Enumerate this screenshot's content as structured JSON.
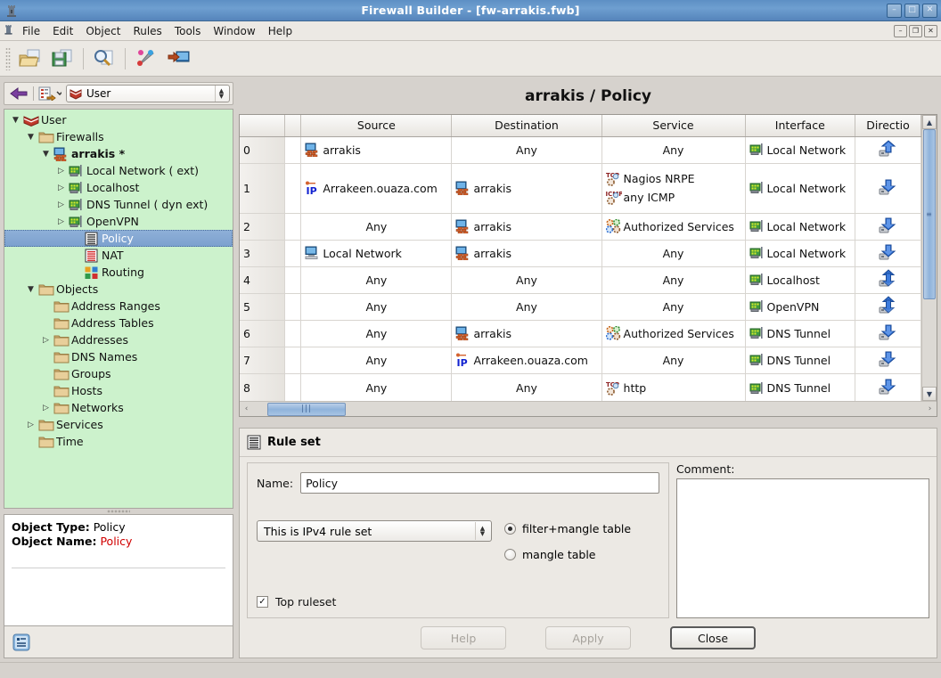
{
  "window": {
    "title": "Firewall Builder  - [fw-arrakis.fwb]",
    "app_icon": "firewall-tower-icon",
    "buttons": {
      "minimize": "–",
      "maximize": "□",
      "close": "✕"
    }
  },
  "menubar": {
    "icon": "firewall-tower-icon",
    "items": [
      "File",
      "Edit",
      "Object",
      "Rules",
      "Tools",
      "Window",
      "Help"
    ],
    "mdi_buttons": {
      "minimize": "–",
      "restore": "❐",
      "close": "✕"
    }
  },
  "toolbar": {
    "buttons": [
      {
        "name": "open-file-button",
        "icon": "open-folder-icon"
      },
      {
        "name": "save-file-button",
        "icon": "floppy-save-icon"
      },
      {
        "name": "find-button",
        "icon": "magnifier-document-icon"
      },
      {
        "name": "compile-button",
        "icon": "wrench-balls-icon"
      },
      {
        "name": "install-button",
        "icon": "install-to-monitor-icon"
      }
    ]
  },
  "navbar": {
    "back_icon": "back-arrow-icon",
    "new_object_icon": "new-object-icon",
    "dropdown_icon": "chevron-down-icon",
    "library_icon": "library-books-icon",
    "library_value": "User"
  },
  "tree": {
    "items": [
      {
        "label": "User",
        "indent": 0,
        "twisty": "down",
        "icon": "library-books-icon",
        "selected": false,
        "bold": false
      },
      {
        "label": "Firewalls",
        "indent": 1,
        "twisty": "down",
        "icon": "folder-icon",
        "selected": false,
        "bold": false
      },
      {
        "label": "arrakis *",
        "indent": 2,
        "twisty": "down",
        "icon": "firewall-icon",
        "selected": false,
        "bold": true
      },
      {
        "label": "Local Network ( ext)",
        "indent": 3,
        "twisty": "right",
        "icon": "interface-card-icon",
        "selected": false,
        "bold": false
      },
      {
        "label": "Localhost",
        "indent": 3,
        "twisty": "right",
        "icon": "interface-card-icon",
        "selected": false,
        "bold": false
      },
      {
        "label": "DNS Tunnel ( dyn ext)",
        "indent": 3,
        "twisty": "right",
        "icon": "interface-card-icon",
        "selected": false,
        "bold": false
      },
      {
        "label": "OpenVPN",
        "indent": 3,
        "twisty": "right",
        "icon": "interface-card-icon",
        "selected": false,
        "bold": false
      },
      {
        "label": "Policy",
        "indent": 4,
        "twisty": "none",
        "icon": "policy-rules-icon",
        "selected": true,
        "bold": false
      },
      {
        "label": "NAT",
        "indent": 4,
        "twisty": "none",
        "icon": "nat-rules-icon",
        "selected": false,
        "bold": false
      },
      {
        "label": "Routing",
        "indent": 4,
        "twisty": "none",
        "icon": "routing-icon",
        "selected": false,
        "bold": false
      },
      {
        "label": "Objects",
        "indent": 1,
        "twisty": "down",
        "icon": "folder-icon",
        "selected": false,
        "bold": false
      },
      {
        "label": "Address Ranges",
        "indent": 2,
        "twisty": "none",
        "icon": "folder-icon",
        "selected": false,
        "bold": false
      },
      {
        "label": "Address Tables",
        "indent": 2,
        "twisty": "none",
        "icon": "folder-icon",
        "selected": false,
        "bold": false
      },
      {
        "label": "Addresses",
        "indent": 2,
        "twisty": "right",
        "icon": "folder-icon",
        "selected": false,
        "bold": false
      },
      {
        "label": "DNS Names",
        "indent": 2,
        "twisty": "none",
        "icon": "folder-icon",
        "selected": false,
        "bold": false
      },
      {
        "label": "Groups",
        "indent": 2,
        "twisty": "none",
        "icon": "folder-icon",
        "selected": false,
        "bold": false
      },
      {
        "label": "Hosts",
        "indent": 2,
        "twisty": "none",
        "icon": "folder-icon",
        "selected": false,
        "bold": false
      },
      {
        "label": "Networks",
        "indent": 2,
        "twisty": "right",
        "icon": "folder-icon",
        "selected": false,
        "bold": false
      },
      {
        "label": "Services",
        "indent": 1,
        "twisty": "right",
        "icon": "folder-icon",
        "selected": false,
        "bold": false
      },
      {
        "label": "Time",
        "indent": 1,
        "twisty": "none",
        "icon": "folder-icon",
        "selected": false,
        "bold": false
      }
    ]
  },
  "object_info": {
    "type_label": "Object Type:",
    "type_value": "Policy",
    "name_label": "Object Name:",
    "name_value": "Policy",
    "name_color": "#d10000",
    "bottom_icon": "object-info-icon"
  },
  "ruleset_view": {
    "title": "arrakis / Policy",
    "columns": [
      "",
      "",
      "Source",
      "Destination",
      "Service",
      "Interface",
      "Directio"
    ],
    "rows": [
      {
        "num": "0",
        "source": [
          {
            "text": "arrakis",
            "icon": "firewall-icon"
          }
        ],
        "destination": [
          {
            "text": "Any",
            "icon": "none"
          }
        ],
        "service": [
          {
            "text": "Any",
            "icon": "none"
          }
        ],
        "interface": [
          {
            "text": "Local Network",
            "icon": "interface-card-icon"
          }
        ],
        "direction": "outbound"
      },
      {
        "num": "1",
        "source": [
          {
            "text": "Arrakeen.ouaza.com",
            "icon": "ip-address-icon"
          }
        ],
        "destination": [
          {
            "text": "arrakis",
            "icon": "firewall-icon"
          }
        ],
        "service": [
          {
            "text": "Nagios NRPE",
            "icon": "tcp-service-icon"
          },
          {
            "text": "any ICMP",
            "icon": "icmp-service-icon"
          }
        ],
        "interface": [
          {
            "text": "Local Network",
            "icon": "interface-card-icon"
          }
        ],
        "direction": "inbound"
      },
      {
        "num": "2",
        "source": [
          {
            "text": "Any",
            "icon": "none"
          }
        ],
        "destination": [
          {
            "text": "arrakis",
            "icon": "firewall-icon"
          }
        ],
        "service": [
          {
            "text": "Authorized Services",
            "icon": "service-group-icon"
          }
        ],
        "interface": [
          {
            "text": "Local Network",
            "icon": "interface-card-icon"
          }
        ],
        "direction": "inbound"
      },
      {
        "num": "3",
        "source": [
          {
            "text": "Local Network",
            "icon": "network-icon"
          }
        ],
        "destination": [
          {
            "text": "arrakis",
            "icon": "firewall-icon"
          }
        ],
        "service": [
          {
            "text": "Any",
            "icon": "none"
          }
        ],
        "interface": [
          {
            "text": "Local Network",
            "icon": "interface-card-icon"
          }
        ],
        "direction": "inbound"
      },
      {
        "num": "4",
        "source": [
          {
            "text": "Any",
            "icon": "none"
          }
        ],
        "destination": [
          {
            "text": "Any",
            "icon": "none"
          }
        ],
        "service": [
          {
            "text": "Any",
            "icon": "none"
          }
        ],
        "interface": [
          {
            "text": "Localhost",
            "icon": "interface-card-icon"
          }
        ],
        "direction": "both"
      },
      {
        "num": "5",
        "source": [
          {
            "text": "Any",
            "icon": "none"
          }
        ],
        "destination": [
          {
            "text": "Any",
            "icon": "none"
          }
        ],
        "service": [
          {
            "text": "Any",
            "icon": "none"
          }
        ],
        "interface": [
          {
            "text": "OpenVPN",
            "icon": "interface-card-icon"
          }
        ],
        "direction": "both"
      },
      {
        "num": "6",
        "source": [
          {
            "text": "Any",
            "icon": "none"
          }
        ],
        "destination": [
          {
            "text": "arrakis",
            "icon": "firewall-icon"
          }
        ],
        "service": [
          {
            "text": "Authorized Services",
            "icon": "service-group-icon"
          }
        ],
        "interface": [
          {
            "text": "DNS Tunnel",
            "icon": "interface-card-icon"
          }
        ],
        "direction": "inbound"
      },
      {
        "num": "7",
        "source": [
          {
            "text": "Any",
            "icon": "none"
          }
        ],
        "destination": [
          {
            "text": "Arrakeen.ouaza.com",
            "icon": "ip-address-icon"
          }
        ],
        "service": [
          {
            "text": "Any",
            "icon": "none"
          }
        ],
        "interface": [
          {
            "text": "DNS Tunnel",
            "icon": "interface-card-icon"
          }
        ],
        "direction": "inbound"
      },
      {
        "num": "8",
        "source": [
          {
            "text": "Any",
            "icon": "none"
          }
        ],
        "destination": [
          {
            "text": "Any",
            "icon": "none"
          }
        ],
        "service": [
          {
            "text": "http",
            "icon": "tcp-service-icon"
          }
        ],
        "interface": [
          {
            "text": "DNS Tunnel",
            "icon": "interface-card-icon"
          }
        ],
        "direction": "inbound"
      }
    ]
  },
  "editor": {
    "header_icon": "policy-rules-icon",
    "header_title": "Rule set",
    "name_label": "Name:",
    "name_value": "Policy",
    "ruleset_type_value": "This is IPv4 rule set",
    "radio_filter_mangle": "filter+mangle table",
    "radio_mangle": "mangle table",
    "radio_selected": "filter+mangle table",
    "top_ruleset_label": "Top ruleset",
    "top_ruleset_checked": true,
    "check_glyph": "✓",
    "comment_label": "Comment:",
    "comment_value": "",
    "buttons": {
      "help": "Help",
      "apply": "Apply",
      "close": "Close"
    }
  }
}
